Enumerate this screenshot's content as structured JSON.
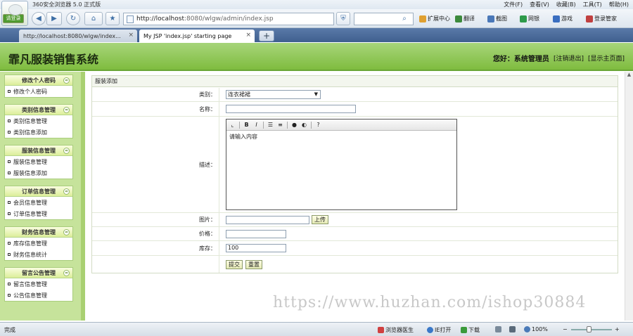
{
  "browser": {
    "title": "360安全浏览器 5.0 正式版",
    "login_label": "请登录",
    "menus": [
      "文件(F)",
      "查看(V)",
      "收藏(B)",
      "工具(T)",
      "帮助(H)"
    ],
    "address_host": "http://localhost",
    "address_path": ":8080/wlgw/admin/index.jsp",
    "toolbar_items": [
      "扩展中心",
      "翻译",
      "截图",
      "网银",
      "游戏",
      "登录管家"
    ],
    "tabs": [
      {
        "label": "http://localhost:8080/wlgw/index..."
      },
      {
        "label": "My JSP 'index.jsp' starting page"
      }
    ],
    "new_tab": "+"
  },
  "header": {
    "site_title": "霏凡服装销售系统",
    "greeting": "您好：系统管理员",
    "logout": "[注销退出]",
    "home": "[显示主页面]"
  },
  "sidebar": {
    "groups": [
      {
        "title": "修改个人密码",
        "items": [
          "修改个人密码"
        ]
      },
      {
        "title": "类别信息管理",
        "items": [
          "类别信息管理",
          "类别信息添加"
        ]
      },
      {
        "title": "服装信息管理",
        "items": [
          "服装信息管理",
          "服装信息添加"
        ]
      },
      {
        "title": "订单信息管理",
        "items": [
          "会员信息管理",
          "订单信息管理"
        ]
      },
      {
        "title": "财务信息管理",
        "items": [
          "库存信息管理",
          "财务信息统计"
        ]
      },
      {
        "title": "留言公告管理",
        "items": [
          "留言信息管理",
          "公告信息管理"
        ]
      }
    ],
    "toggle": "≈"
  },
  "form": {
    "title": "服装添加",
    "category_label": "类别：",
    "category_value": "连衣裙裙",
    "name_label": "名称：",
    "name_value": "",
    "desc_label": "描述：",
    "desc_value": "请输入内容",
    "image_label": "图片：",
    "image_value": "",
    "upload_button": "上传",
    "price_label": "价格：",
    "price_value": "",
    "stock_label": "库存：",
    "stock_value": "100",
    "submit_button": "提交",
    "reset_button": "重置",
    "editor_tools": [
      "B",
      "I"
    ]
  },
  "watermark": "https://www.huzhan.com/ishop30884",
  "status": {
    "text": "完成",
    "doctor": "浏览器医生",
    "ie_open": "IE打开",
    "download": "下载",
    "zoom": "100%"
  }
}
